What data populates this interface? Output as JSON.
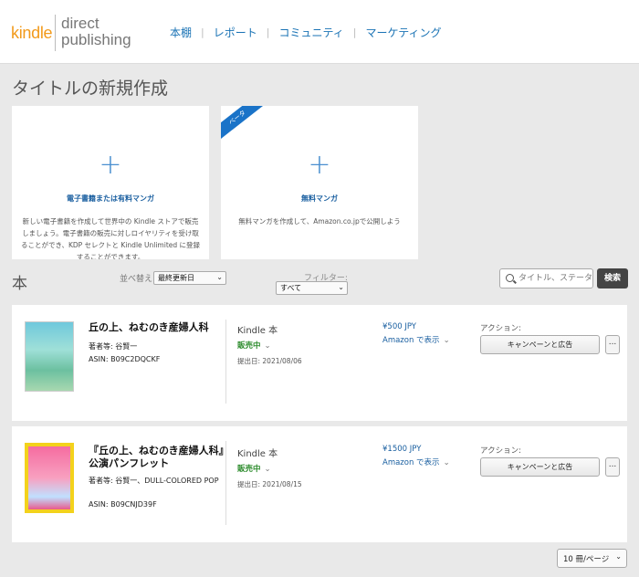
{
  "header": {
    "logo_kindle": "kindle",
    "logo_dp_line1": "direct",
    "logo_dp_line2": "publishing",
    "nav": [
      "本棚",
      "レポート",
      "コミュニティ",
      "マーケティング"
    ],
    "nav_sep": "|"
  },
  "page_title": "タイトルの新規作成",
  "create_cards": [
    {
      "plus": "+",
      "title": "電子書籍または有料マンガ",
      "desc": "新しい電子書籍を作成して世界中の Kindle ストアで販売しましょう。電子書籍の販売に対しロイヤリティを受け取ることができ、KDP セレクトと Kindle Unlimited に登録することができます。"
    },
    {
      "plus": "+",
      "ribbon": "ベータ",
      "title": "無料マンガ",
      "desc": "無料マンガを作成して、Amazon.co.jpで公開しよう"
    }
  ],
  "books": {
    "heading": "本",
    "sort_label": "並べ替え",
    "sort_value": "最終更新日",
    "filter_label": "フィルター:",
    "filter_value": "すべて",
    "search_placeholder": "タイトル、ステータス",
    "search_button": "検索",
    "rows": [
      {
        "title": "丘の上、ねむのき産婦人科",
        "author": "著者等: 谷賢一",
        "asin": "ASIN: B09C2DQCKF",
        "format": "Kindle 本",
        "status": "販売中",
        "pubdate": "提出日: 2021/08/06",
        "price": "¥500 JPY",
        "view_amazon": "Amazon で表示",
        "action_label": "アクション:",
        "campaign_button": "キャンペーンと広告",
        "more": "..."
      },
      {
        "title": "『丘の上、ねむのき産婦人科』公演パンフレット",
        "author": "著者等: 谷賢一、DULL-COLORED POP",
        "asin": "ASIN: B09CNJD39F",
        "format": "Kindle 本",
        "status": "販売中",
        "pubdate": "提出日: 2021/08/15",
        "price": "¥1500 JPY",
        "view_amazon": "Amazon で表示",
        "action_label": "アクション:",
        "campaign_button": "キャンペーンと広告",
        "more": "..."
      }
    ]
  },
  "pagination": {
    "per_page": "10 冊/ページ"
  },
  "colors": {
    "brand_orange": "#f29a1b",
    "link_blue": "#1a73b5",
    "status_green": "#2a8a2a"
  }
}
